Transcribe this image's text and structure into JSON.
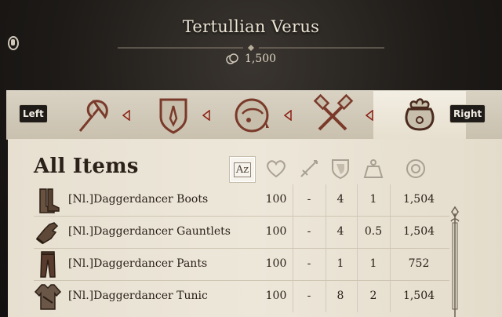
{
  "header": {
    "merchant_name": "Tertullian Verus",
    "currency_amount": "1,500"
  },
  "tabs": {
    "left_key": "Left",
    "right_key": "Right",
    "items": [
      {
        "name": "tab-weapons",
        "icon": "axe-icon"
      },
      {
        "name": "tab-armor",
        "icon": "shield-emblem-icon"
      },
      {
        "name": "tab-consumables",
        "icon": "potion-icon"
      },
      {
        "name": "tab-tools",
        "icon": "crossed-tools-icon"
      },
      {
        "name": "tab-all-items",
        "icon": "pouch-icon",
        "active": true
      }
    ]
  },
  "panel": {
    "title": "All Items",
    "sort_label": "Az",
    "columns": [
      "sort-az-icon",
      "durability-heart-icon",
      "damage-sword-icon",
      "defense-shield-icon",
      "weight-icon",
      "price-coin-icon"
    ]
  },
  "rows": [
    {
      "name": "[Nl.]Daggerdancer Boots",
      "durability": "100",
      "damage": "-",
      "defense": "4",
      "weight": "1",
      "price": "1,504",
      "icon": "boots-icon"
    },
    {
      "name": "[Nl.]Daggerdancer Gauntlets",
      "durability": "100",
      "damage": "-",
      "defense": "4",
      "weight": "0.5",
      "price": "1,504",
      "icon": "gauntlets-icon"
    },
    {
      "name": "[Nl.]Daggerdancer Pants",
      "durability": "100",
      "damage": "-",
      "defense": "1",
      "weight": "1",
      "price": "752",
      "icon": "pants-icon"
    },
    {
      "name": "[Nl.]Daggerdancer Tunic",
      "durability": "100",
      "damage": "-",
      "defense": "8",
      "weight": "2",
      "price": "1,504",
      "icon": "tunic-icon"
    }
  ],
  "colors": {
    "parchment": "#ebe4d6",
    "accent": "#8a1f12",
    "text": "#2a2018"
  }
}
